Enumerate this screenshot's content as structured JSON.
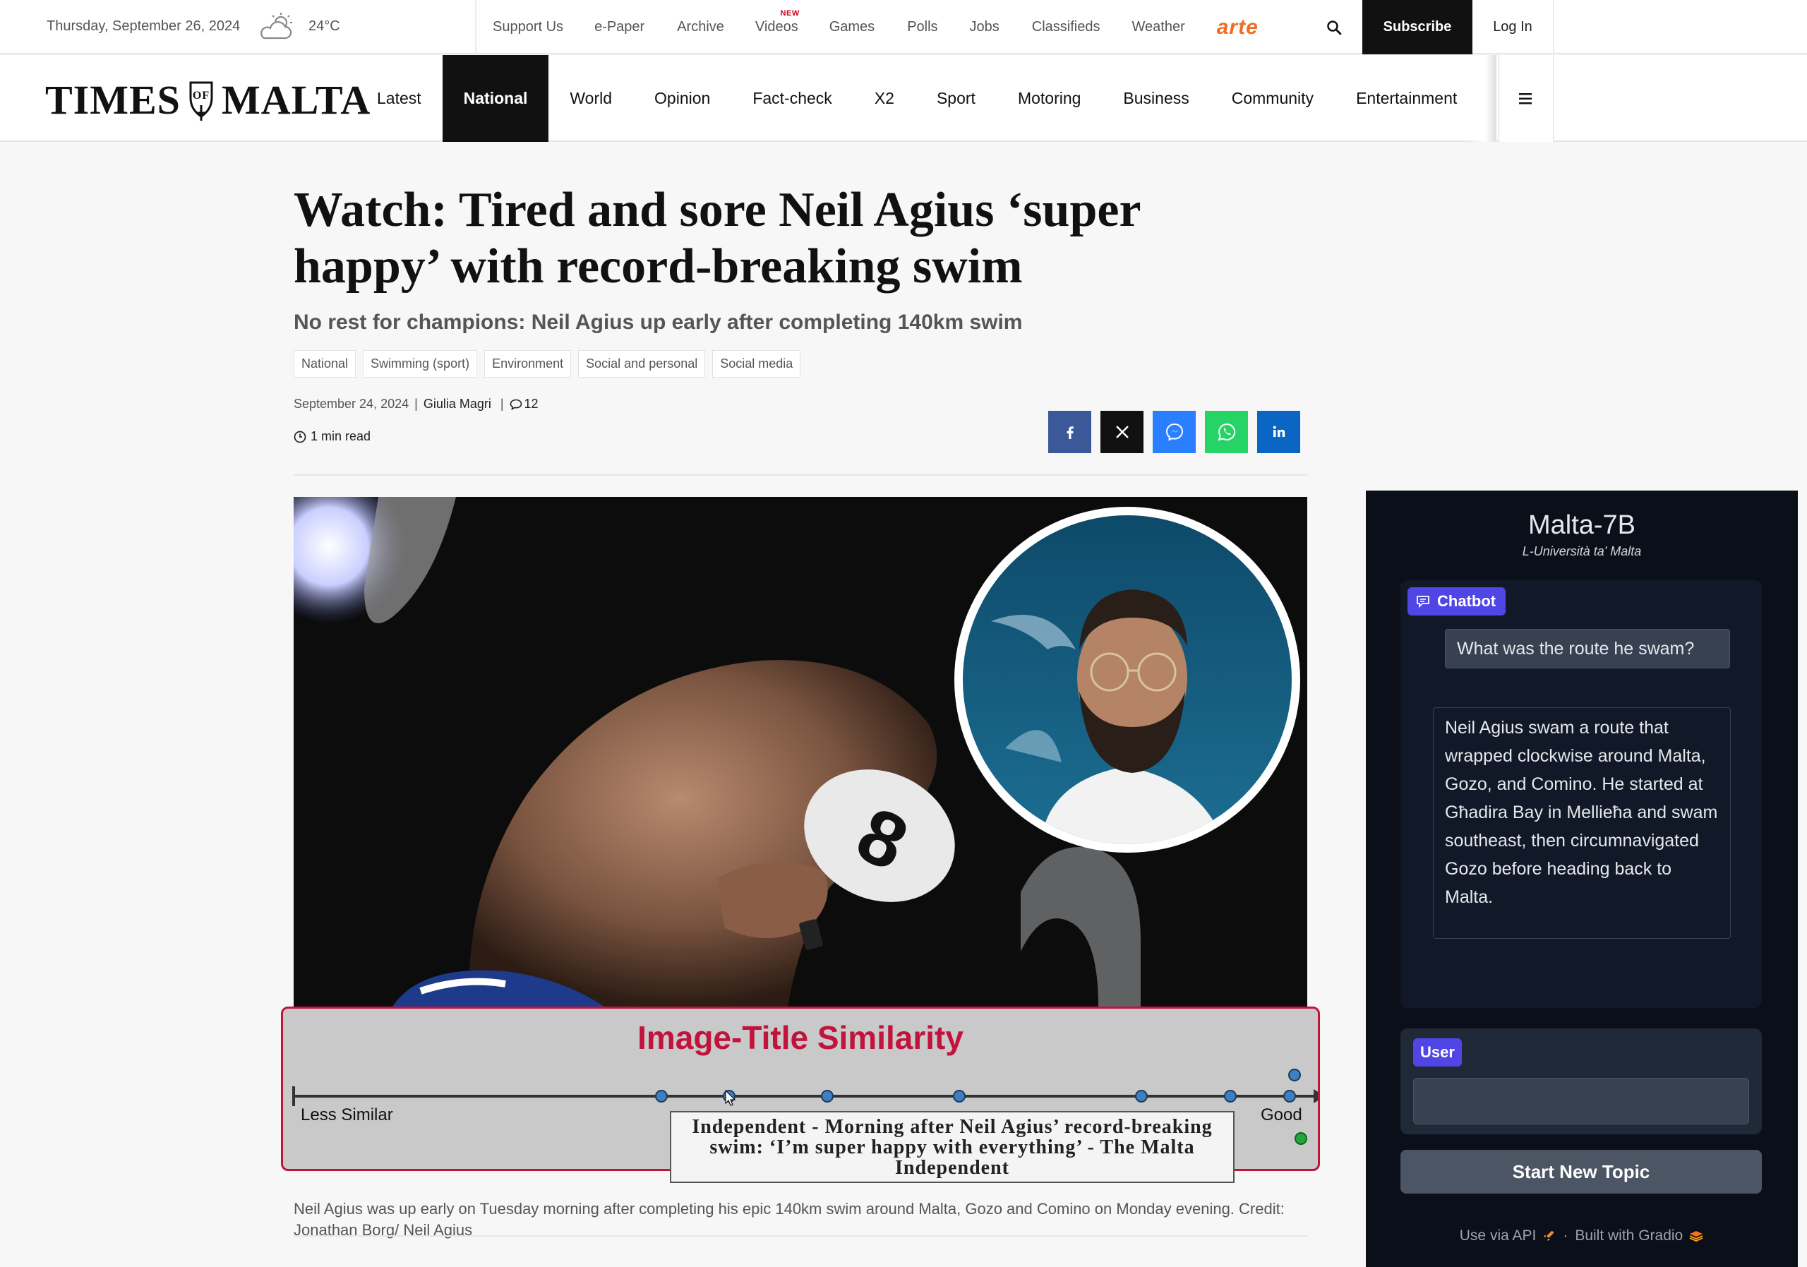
{
  "utility": {
    "date": "Thursday, September 26, 2024",
    "temperature": "24°C",
    "weather_icon": "partly-cloudy-icon",
    "links": [
      "Support Us",
      "e-Paper",
      "Archive",
      "Videos",
      "Games",
      "Polls",
      "Jobs",
      "Classifieds",
      "Weather"
    ],
    "videos_badge": "NEW",
    "partner": "arte",
    "subscribe": "Subscribe",
    "login": "Log In"
  },
  "nav": {
    "logo_left": "TIMES",
    "logo_crest": "OF",
    "logo_right": "MALTA",
    "items": [
      "Latest",
      "National",
      "World",
      "Opinion",
      "Fact-check",
      "X2",
      "Sport",
      "Motoring",
      "Business",
      "Community",
      "Entertainment"
    ],
    "active": "National"
  },
  "article": {
    "headline": "Watch: Tired and sore Neil Agius ‘super happy’ with record-breaking swim",
    "subheadline": "No rest for champions: Neil Agius up early after completing 140km swim",
    "tags": [
      "National",
      "Swimming (sport)",
      "Environment",
      "Social and personal",
      "Social media"
    ],
    "date": "September 24, 2024",
    "author": "Giulia Magri",
    "comments": "12",
    "read_time": "1 min read",
    "caption": "Neil Agius was up early on Tuesday morning after completing his epic 140km swim around Malta, Gozo and Comino on Monday evening. Credit: Jonathan Borg/ Neil Agius",
    "cap_text": "8"
  },
  "share": {
    "icons": [
      "facebook-icon",
      "x-icon",
      "messenger-icon",
      "whatsapp-icon",
      "linkedin-icon"
    ],
    "colors": [
      "#3b5998",
      "#111111",
      "#2a7fff",
      "#25d366",
      "#0a66c2"
    ]
  },
  "similarity": {
    "title": "Image-Title Similarity",
    "low_label": "Less Similar",
    "high_label": "Good",
    "tooltip": "Independent - Morning after Neil Agius’ record-breaking swim: ‘I’m super happy with everything’ - The Malta Independent",
    "accent": "#c0143c"
  },
  "chatbot": {
    "title": "Malta-7B",
    "subtitle": "L-Università ta' Malta",
    "chat_label": "Chatbot",
    "user_message": "What was the route he swam?",
    "bot_message": "Neil Agius swam a route that wrapped clockwise around Malta, Gozo, and Comino. He started at Għadira Bay in Mellieħa and swam southeast, then circumnavigated Gozo before heading back to Malta.",
    "user_label": "User",
    "input_value": "",
    "new_topic": "Start New Topic",
    "footer_api": "Use via API",
    "footer_sep": "·",
    "footer_built": "Built with Gradio",
    "accent": "#4f46e5"
  }
}
